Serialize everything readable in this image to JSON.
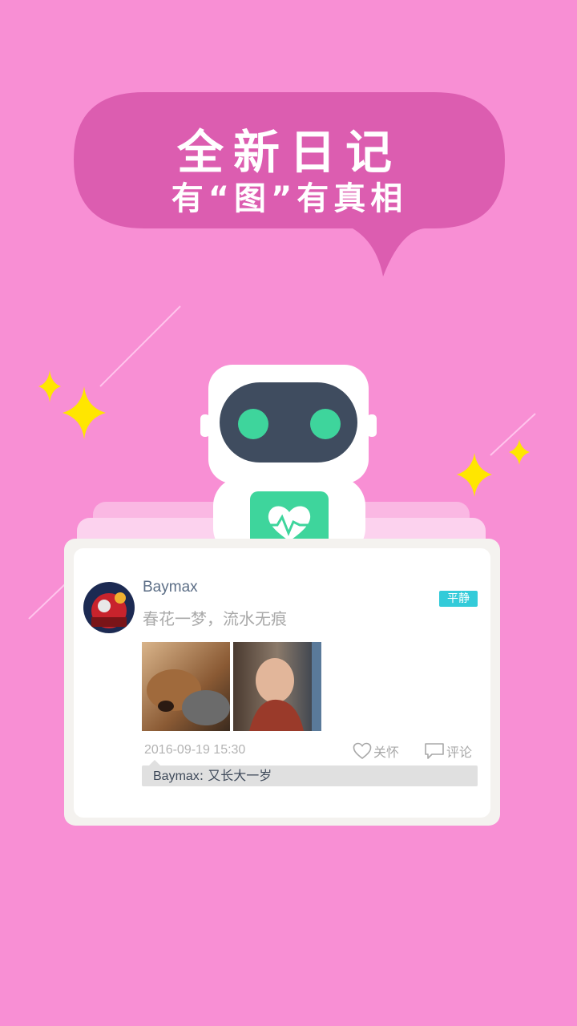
{
  "banner": {
    "title": "全新日记",
    "subtitle": "有“图”有真相"
  },
  "post": {
    "author": "Baymax",
    "text": "春花一梦，流水无痕",
    "mood": "平静",
    "timestamp": "2016-09-19 15:30",
    "care_label": "关怀",
    "comment_label": "评论",
    "comments": [
      {
        "author": "Baymax",
        "separator": ": ",
        "text": "又长大一岁"
      }
    ]
  },
  "colors": {
    "background": "#F88FD4",
    "bubble": "#DC5DB0",
    "robot_face": "#3F4C5F",
    "robot_eyes": "#3ED59C",
    "mood_badge": "#33CBD9",
    "sparkle": "#FFE600"
  },
  "icons": [
    "sparkle-icon",
    "heart-outline-icon",
    "comment-bubble-icon",
    "heartbeat-icon"
  ]
}
